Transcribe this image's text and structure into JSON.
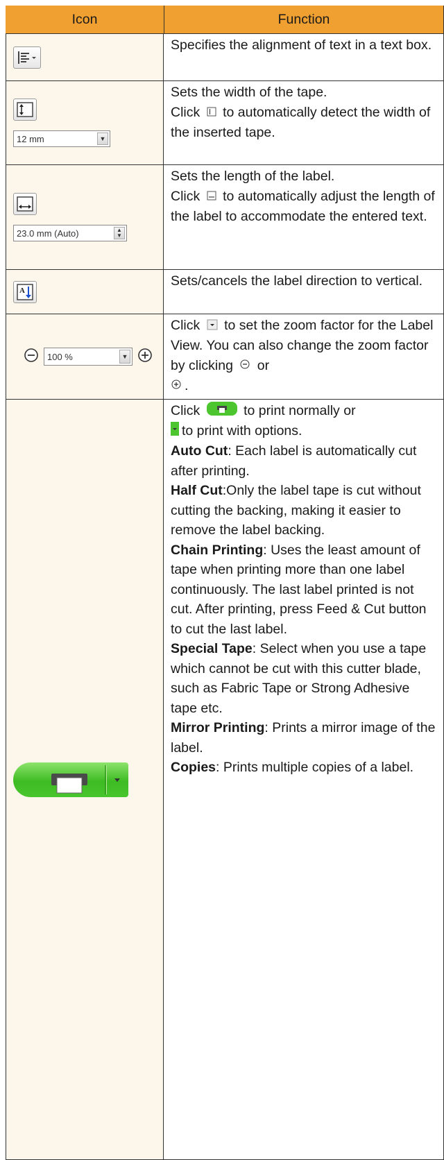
{
  "header": {
    "icon_col": "Icon",
    "function_col": "Function"
  },
  "rows": {
    "align": {
      "desc": "Specifies the alignment of text in a text box."
    },
    "width": {
      "combo_value": "12 mm",
      "p1": "Sets the width of the tape.",
      "p2a": "Click",
      "p2b": "to automatically detect the width of the inserted tape."
    },
    "length": {
      "combo_value": "23.0 mm (Auto)",
      "p1": "Sets the length of the label.",
      "p2a": "Click",
      "p2b": "to automatically adjust the length of the label to accommodate the entered text."
    },
    "direction": {
      "desc": "Sets/cancels the label direction to vertical."
    },
    "zoom": {
      "combo_value": "100 %",
      "p1a": "Click",
      "p1b": "to set the zoom factor for the Label View.",
      "p2a": "You can also change the zoom factor by clicking",
      "p2b": "or",
      "p2c": "."
    },
    "print": {
      "intro_a": "Click",
      "intro_b": "to print normally or",
      "intro_c": "to print with options.",
      "auto_cut_label": "Auto Cut",
      "auto_cut_text": ": Each label is automatically cut after printing.",
      "half_cut_label": "Half Cut",
      "half_cut_text": ":Only the label tape is cut without cutting the backing, making it easier to remove the label backing.",
      "chain_label": "Chain Printing",
      "chain_text": ": Uses the least amount of tape when printing more than one label continuously. The last label printed is not cut. After printing, press Feed & Cut button to cut the last label.",
      "special_label": "Special Tape",
      "special_text": ": Select when you use a tape which cannot be cut with this cutter blade, such as Fabric Tape or Strong Adhesive tape etc.",
      "mirror_label": "Mirror Printing",
      "mirror_text": ": Prints a mirror image of the label.",
      "copies_label": "Copies",
      "copies_text": ": Prints multiple copies of a label."
    }
  },
  "colors": {
    "header_bg": "#f0a030",
    "icon_cell_bg": "#fdf6ea",
    "print_green": "#3dbb22"
  }
}
